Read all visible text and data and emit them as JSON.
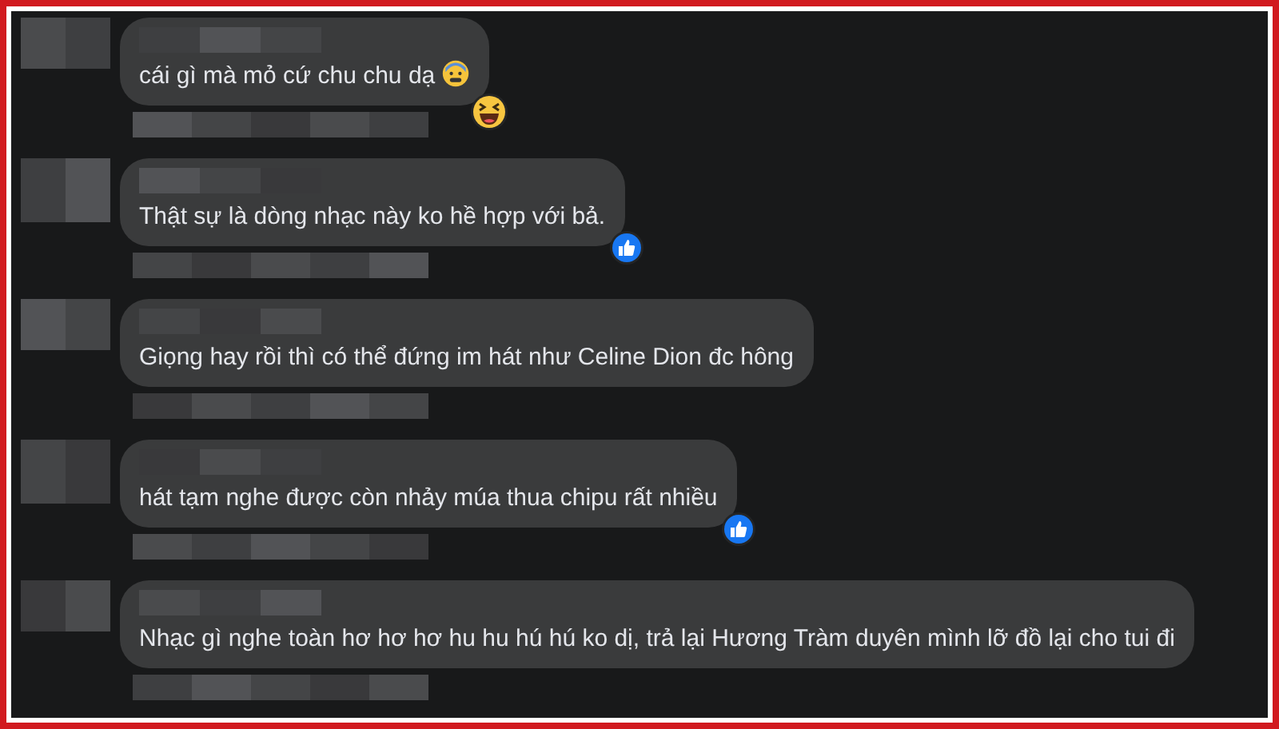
{
  "comments": [
    {
      "text": "cái gì mà mỏ cứ chu chu dạ",
      "anxious_emoji": true,
      "haha_reaction": true,
      "like_reaction": false
    },
    {
      "text": "Thật sự là dòng nhạc này ko hề hợp với bả.",
      "haha_reaction": false,
      "like_reaction": true
    },
    {
      "text": "Giọng hay rồi thì có thể đứng im hát như Celine Dion đc hông",
      "haha_reaction": false,
      "like_reaction": false
    },
    {
      "text": "hát tạm nghe được còn nhảy múa thua chipu rất nhiều",
      "haha_reaction": false,
      "like_reaction": true
    },
    {
      "text": "Nhạc gì nghe toàn hơ hơ hơ hu hu hú hú ko dị, trả lại Hương Tràm duyên mình lỡ đồ lại cho tui đi",
      "haha_reaction": false,
      "like_reaction": false
    }
  ]
}
